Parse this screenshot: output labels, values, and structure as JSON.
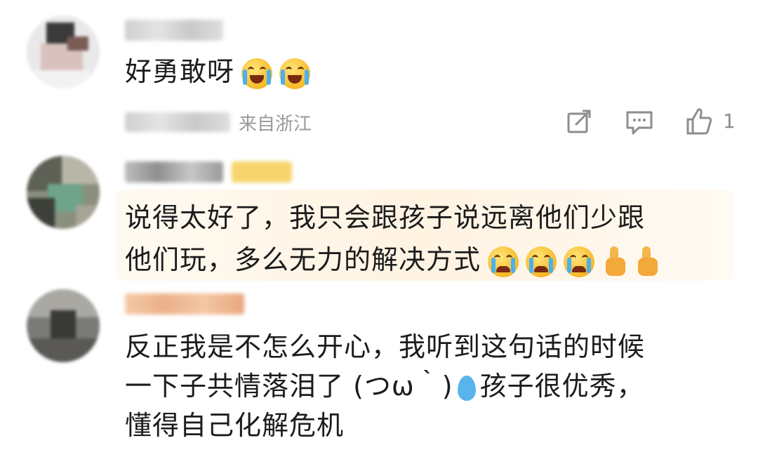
{
  "comments": [
    {
      "text": "好勇敢呀",
      "meta": {
        "location": "来自浙江"
      },
      "actions": {
        "like_count": "1"
      }
    },
    {
      "line1": "说得太好了，我只会跟孩子说远离他们少跟",
      "line2": "他们玩，多么无力的解决方式"
    },
    {
      "line1": "反正我是不怎么开心，我听到这句话的时候",
      "line2_a": "一下子共情落泪了 (つω｀)",
      "line2_b": "孩子很优秀，",
      "line3": "懂得自己化解危机"
    }
  ],
  "icons": {
    "repost": "share-square-icon",
    "reply": "comment-icon",
    "like": "thumb-up-icon",
    "emoji_laugh_cry": "laugh-cry-emoji",
    "emoji_cry": "crying-emoji",
    "emoji_thumb": "thumbs-up-emoji",
    "emoji_drop": "droplet-emoji"
  },
  "colors": {
    "text": "#1c1c1c",
    "meta": "#9a9a9a",
    "badge": "#f7d36b",
    "highlight": "#fff3e2"
  }
}
